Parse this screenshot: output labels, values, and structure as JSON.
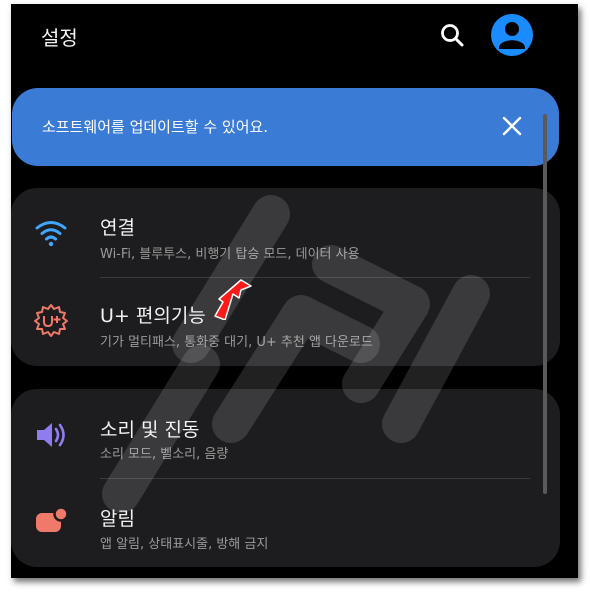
{
  "header": {
    "title": "설정",
    "search_icon": "search-icon",
    "avatar_icon": "account-icon"
  },
  "banner": {
    "text": "소프트웨어를 업데이트할 수 있어요.",
    "close_icon": "close-icon"
  },
  "sections": [
    {
      "items": [
        {
          "icon": "wifi-icon",
          "label": "연결",
          "subtitle": "Wi-Fi, 블루투스, 비행기 탑승 모드, 데이터 사용"
        },
        {
          "icon": "gear-uplus-icon",
          "label": "U+ 편의기능",
          "subtitle": "기가 멀티패스, 통화중 대기, U+ 추천 앱 다운로드"
        }
      ]
    },
    {
      "items": [
        {
          "icon": "speaker-icon",
          "label": "소리 및 진동",
          "subtitle": "소리 모드, 벨소리, 음량"
        },
        {
          "icon": "notification-icon",
          "label": "알림",
          "subtitle": "앱 알림, 상태표시줄, 방해 금지"
        }
      ]
    }
  ],
  "annotation": {
    "arrow_icon": "red-arrow-icon"
  },
  "colors": {
    "background": "#000000",
    "card": "#1d1d1f",
    "banner": "#3a7bd5",
    "accent_blue": "#1a8cff",
    "wifi": "#3ea6ff",
    "uplus": "#f07a6a",
    "speaker": "#8f7cf0",
    "notification": "#f07a6a",
    "arrow": "#ff1a1a"
  }
}
